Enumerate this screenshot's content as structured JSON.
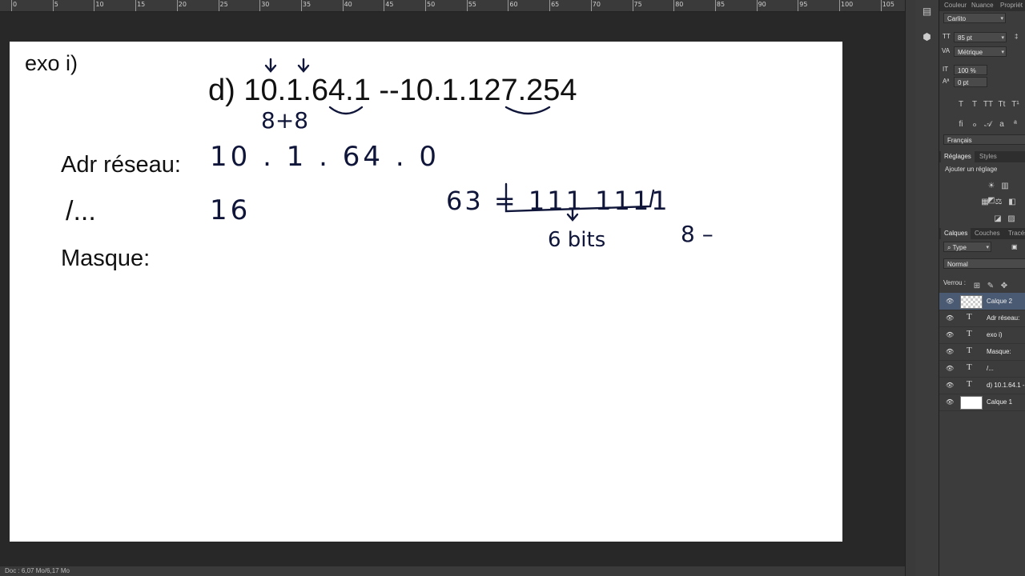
{
  "ruler": {
    "labels": [
      "0",
      "5",
      "10",
      "15",
      "20",
      "25",
      "30",
      "35",
      "40",
      "45",
      "50",
      "55",
      "60",
      "65",
      "70",
      "75",
      "80",
      "85",
      "90",
      "95",
      "100",
      "105"
    ]
  },
  "document": {
    "exo_label": "exo i)",
    "question": "d) 10.1.64.1 --10.1.127.254",
    "adr_label": "Adr réseau:",
    "prefix_label": "/...",
    "masque_label": "Masque:",
    "handwriting": {
      "sum": "8+8",
      "network_address": "10 . 1 . 64 . 0",
      "prefix_value": "16",
      "binary": "63 = 111 1111",
      "bits": "6 bits",
      "eight": "8 –"
    }
  },
  "status_bar": {
    "text": "Doc : 6,07 Mo/6,17 Mo"
  },
  "tool_icons": [
    "history-icon",
    "3d-cube-icon"
  ],
  "character_panel": {
    "tabs": [
      "Couleur",
      "Nuance",
      "Propriét"
    ],
    "font_family": "Carlito",
    "font_size": "85 pt",
    "kerning": "Métrique",
    "scale": "100 %",
    "baseline": "0 pt",
    "language": "Français"
  },
  "adjustments_panel": {
    "tabs": [
      "Réglages",
      "Styles"
    ],
    "title": "Ajouter un réglage"
  },
  "layers_panel": {
    "tabs": [
      "Calques",
      "Couches",
      "Tracés"
    ],
    "filter": "Type",
    "blend_mode": "Normal",
    "lock_label": "Verrou :",
    "layers": [
      {
        "name": "Calque 2",
        "kind": "pixel-transparent",
        "selected": true
      },
      {
        "name": "Adr réseau:",
        "kind": "text"
      },
      {
        "name": "exo i)",
        "kind": "text"
      },
      {
        "name": "Masque:",
        "kind": "text"
      },
      {
        "name": "/...",
        "kind": "text"
      },
      {
        "name": "d) 10.1.64.1 --",
        "kind": "text"
      },
      {
        "name": "Calque 1",
        "kind": "pixel-white"
      }
    ]
  }
}
